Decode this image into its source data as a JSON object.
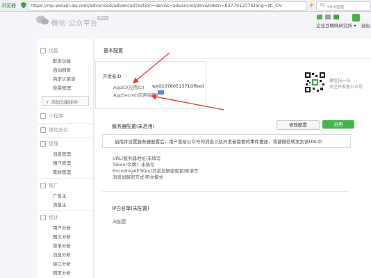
{
  "browser": {
    "label": "浏览器",
    "url": "https://mp.weixin.qq.com/advanced/advanced?action=dev&t=advanced/dev&token=637701377&lang=zh_CN",
    "search_placeholder": "360搜索"
  },
  "header": {
    "logo_text": "微信·公众平台",
    "logo_badge": "Beta",
    "account_name": "企业互联网研究所 ▾",
    "logout": "退出"
  },
  "sidebar": {
    "groups": [
      {
        "label": "功能",
        "items": [
          "群发功能",
          "自动回复",
          "自定义菜单",
          "投票管理"
        ]
      },
      {
        "label": "小程序",
        "items": []
      },
      {
        "label": "微信支付",
        "items": []
      },
      {
        "label": "管理",
        "items": [
          "消息管理",
          "用户管理",
          "素材管理"
        ]
      },
      {
        "label": "推广",
        "items": [
          "广告主",
          "流量主"
        ]
      },
      {
        "label": "统计",
        "items": [
          "用户分析",
          "图文分析",
          "菜单分析",
          "消息分析",
          "接口分析",
          "网页分析"
        ]
      }
    ],
    "add_function": "+ 添加功能插件"
  },
  "main": {
    "title": "基本配置",
    "developer_id": {
      "heading": "开发者ID",
      "appid_label": "AppID(应用ID)",
      "appid_value": "wx02378051371Ofbed",
      "secret_label": "AppSecret(应用密钥)"
    },
    "qr": {
      "line1": "微信扫一扫",
      "line2": "关注开发者公众号"
    },
    "server": {
      "title": "服务器配置(未启用)",
      "modify_button": "修改配置",
      "enable_button": "启用",
      "notice": "启用并设置服务器配置后，用户发给公众号的消息以及开发者需要的事件推送，将被微信转发到该URL中",
      "rows": [
        {
          "label": "URL(服务器地址)",
          "value": "未填写"
        },
        {
          "label": "Token(令牌)",
          "value": "未填写"
        },
        {
          "label": "EncodingAESKey(消息加解密密钥)",
          "value": "未填写"
        },
        {
          "label": "消息加解密方式",
          "value": "明文模式"
        }
      ]
    },
    "whitelist": {
      "title": "IP白名单(未配置)",
      "value": "未配置"
    }
  },
  "colors": {
    "accent_green": "#44b549",
    "arrow_red": "#e53935"
  }
}
